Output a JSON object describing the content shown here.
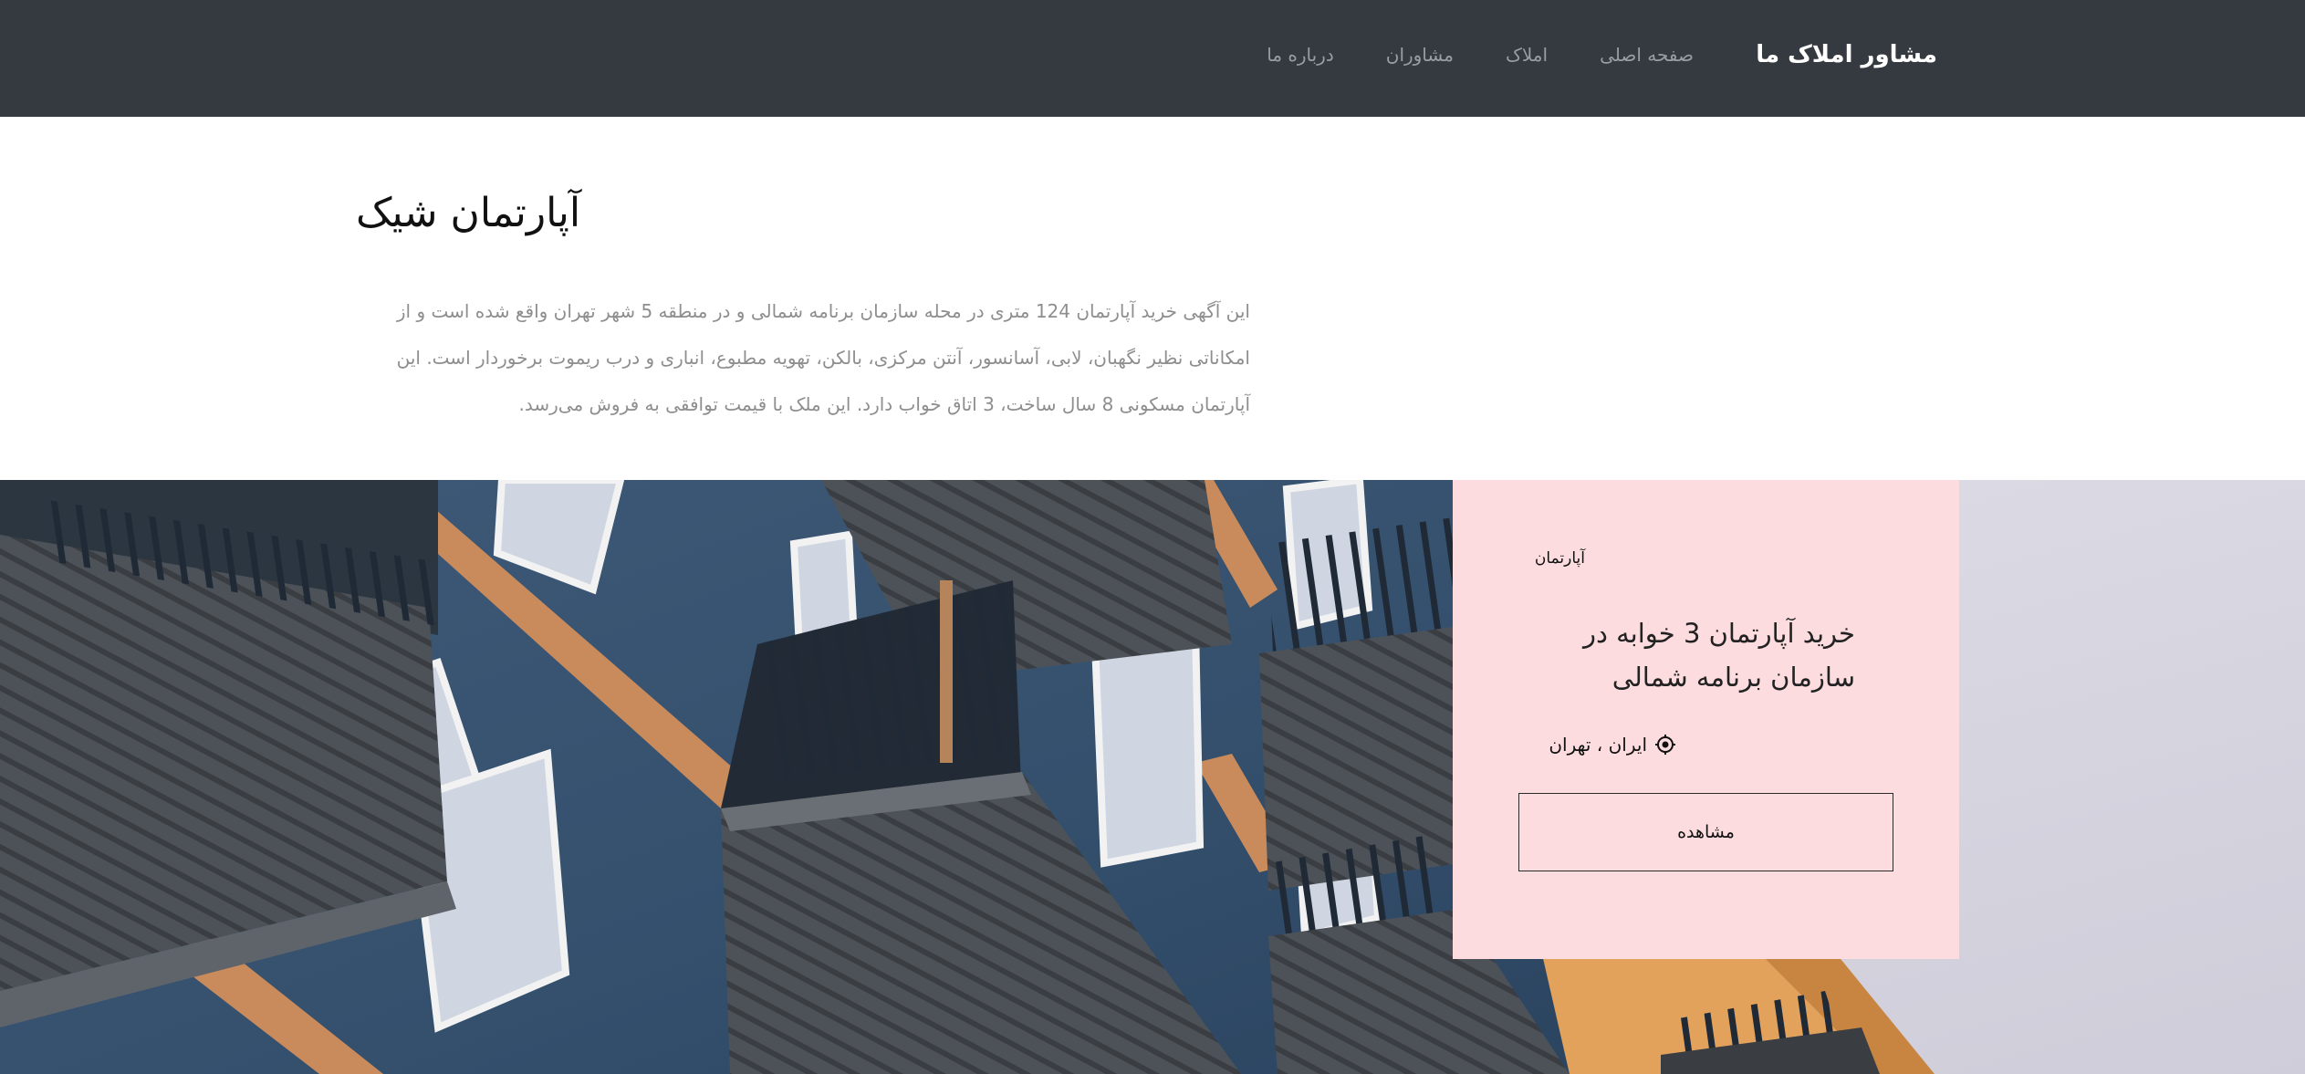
{
  "navbar": {
    "brand": "مشاور املاک ما",
    "links": [
      {
        "label": "صفحه اصلی"
      },
      {
        "label": "املاک"
      },
      {
        "label": "مشاوران"
      },
      {
        "label": "درباره ما"
      }
    ],
    "background_color": "#343a40"
  },
  "intro": {
    "title": "آپارتمان شیک",
    "description": "این آگهی خرید آپارتمان 124 متری در محله سازمان برنامه شمالی و در منطقه 5 شهر تهران واقع شده است و از امکاناتی نظیر نگهبان، لابی، آسانسور، آنتن مرکزی، بالکن، تهویه مطبوع، انباری و درب ریموت برخوردار است. این آپارتمان مسکونی 8 سال ساخت، 3 اتاق خواب دارد. این ملک با قیمت توافقی به فروش می‌رسد."
  },
  "hero": {
    "photo_icon": "apartment-building-balconies-photo"
  },
  "card": {
    "type": "آپارتمان",
    "title": "خرید آپارتمان 3 خوابه در سازمان برنامه شمالی",
    "location": "ایران ، تهران",
    "location_icon": "map-marker-icon",
    "button_label": "مشاهده",
    "background_color": "#fcdcdf"
  }
}
